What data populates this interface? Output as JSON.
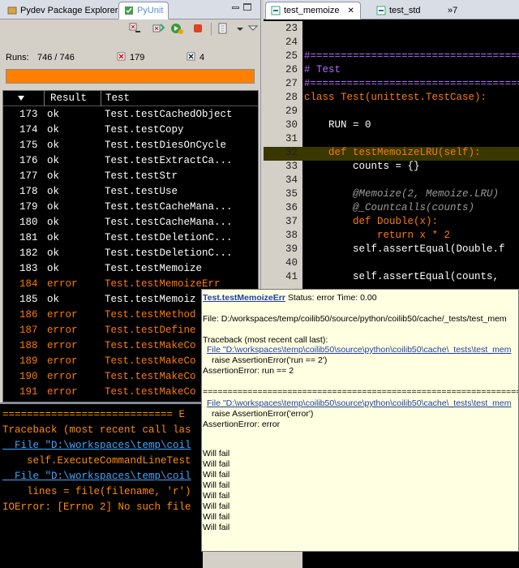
{
  "left_tabs": {
    "explorer": "Pydev Package Explorer",
    "pyunit": "PyUnit"
  },
  "runs": {
    "label": "Runs:",
    "value": "746 / 746",
    "errors": "179",
    "failures": "4"
  },
  "progress": {
    "percent": 100,
    "color": "#ff7f00"
  },
  "table": {
    "columns": [
      "Result",
      "Test"
    ],
    "rows": [
      {
        "n": "173",
        "r": "ok",
        "t": "Test.testCachedObject"
      },
      {
        "n": "174",
        "r": "ok",
        "t": "Test.testCopy"
      },
      {
        "n": "175",
        "r": "ok",
        "t": "Test.testDiesOnCycle"
      },
      {
        "n": "176",
        "r": "ok",
        "t": "Test.testExtractCa..."
      },
      {
        "n": "177",
        "r": "ok",
        "t": "Test.testStr"
      },
      {
        "n": "178",
        "r": "ok",
        "t": "Test.testUse"
      },
      {
        "n": "179",
        "r": "ok",
        "t": "Test.testCacheMana..."
      },
      {
        "n": "180",
        "r": "ok",
        "t": "Test.testCacheMana..."
      },
      {
        "n": "181",
        "r": "ok",
        "t": "Test.testDeletionC..."
      },
      {
        "n": "182",
        "r": "ok",
        "t": "Test.testDeletionC..."
      },
      {
        "n": "183",
        "r": "ok",
        "t": "Test.testMemoize"
      },
      {
        "n": "184",
        "r": "error",
        "t": "Test.testMemoizeErr"
      },
      {
        "n": "185",
        "r": "ok",
        "t": "Test.testMemoiz"
      },
      {
        "n": "186",
        "r": "error",
        "t": "Test.testMethod"
      },
      {
        "n": "187",
        "r": "error",
        "t": "Test.testDefine"
      },
      {
        "n": "188",
        "r": "error",
        "t": "Test.testMakeCo"
      },
      {
        "n": "189",
        "r": "error",
        "t": "Test.testMakeCo"
      },
      {
        "n": "190",
        "r": "error",
        "t": "Test.testMakeCo"
      },
      {
        "n": "191",
        "r": "error",
        "t": "Test.testMakeCo"
      }
    ]
  },
  "console": {
    "lines": [
      "============================ E",
      "Traceback (most recent call las",
      "  File \"D:\\workspaces\\temp\\coil",
      "    self.ExecuteCommandLineTest",
      "  File \"D:\\workspaces\\temp\\coil",
      "    lines = file(filename, 'r')",
      "IOError: [Errno 2] No such file"
    ]
  },
  "editor_tabs": {
    "active": "test_memoize",
    "other": "test_std",
    "overflow": "»7"
  },
  "editor": {
    "lines": [
      {
        "n": "23",
        "c": ""
      },
      {
        "n": "24",
        "c": ""
      },
      {
        "n": "25",
        "c": "#============================================"
      },
      {
        "n": "26",
        "c": "# Test"
      },
      {
        "n": "27",
        "c": "#============================================"
      },
      {
        "n": "28",
        "c": "class Test(unittest.TestCase):"
      },
      {
        "n": "29",
        "c": ""
      },
      {
        "n": "30",
        "c": "    RUN = 0"
      },
      {
        "n": "31",
        "c": ""
      },
      {
        "n": "32",
        "c": "    def testMemoizeLRU(self):"
      },
      {
        "n": "33",
        "c": "        counts = {}"
      },
      {
        "n": "34",
        "c": ""
      },
      {
        "n": "35",
        "c": "        @Memoize(2, Memoize.LRU)"
      },
      {
        "n": "36",
        "c": "        @_Countcalls(counts)"
      },
      {
        "n": "37",
        "c": "        def Double(x):"
      },
      {
        "n": "38",
        "c": "            return x * 2"
      },
      {
        "n": "39",
        "c": "        self.assertEqual(Double.f"
      },
      {
        "n": "40",
        "c": ""
      },
      {
        "n": "41",
        "c": "        self.assertEqual(counts,"
      }
    ]
  },
  "tooltip": {
    "test_name": "Test.testMemoizeErr",
    "status": " Status: error Time: 0.00",
    "file": "File: D:/workspaces/temp/coilib50/source/python/coilib50/cache/_tests/test_mem",
    "tb": "Traceback (most recent call last):",
    "link1": "File \"D:\\workspaces\\temp\\coilib50\\source\\python\\coilib50\\cache\\_tests\\test_mem",
    "raise1": "raise AssertionError('run == 2')",
    "err1": "AssertionError: run == 2",
    "sep": "========================================================================",
    "link2": "File \"D:\\workspaces\\temp\\coilib50\\source\\python\\coilib50\\cache\\_tests\\test_mem",
    "raise2": "raise AssertionError('error')",
    "err2": "AssertionError: error",
    "will": [
      "Will fail",
      "Will fail",
      "Will fail",
      "Will fail",
      "Will fail",
      "Will fail",
      "Will fail",
      "Will fail"
    ]
  }
}
